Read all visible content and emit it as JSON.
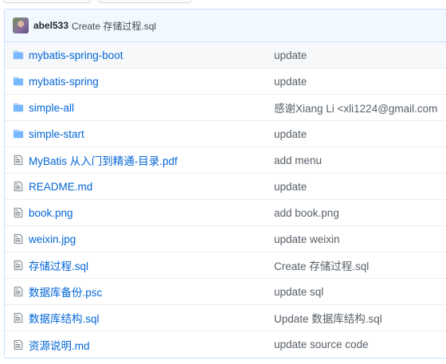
{
  "commit": {
    "author": "abel533",
    "message": "Create 存储过程.sql"
  },
  "colors": {
    "link": "#0366d6",
    "folder_icon": "#79b8ff",
    "file_icon": "#6a737d",
    "header_bg": "#f1f8ff"
  },
  "files": [
    {
      "type": "folder",
      "icon": "folder-icon",
      "name": "mybatis-spring-boot",
      "message": "update"
    },
    {
      "type": "folder",
      "icon": "folder-icon",
      "name": "mybatis-spring",
      "message": "update"
    },
    {
      "type": "folder",
      "icon": "folder-icon",
      "name": "simple-all",
      "message": "感谢Xiang Li <xli1224@gmail.com"
    },
    {
      "type": "folder",
      "icon": "folder-icon",
      "name": "simple-start",
      "message": "update"
    },
    {
      "type": "file",
      "icon": "file-icon",
      "name": "MyBatis 从入门到精通-目录.pdf",
      "message": "add menu"
    },
    {
      "type": "file",
      "icon": "file-icon",
      "name": "README.md",
      "message": "update"
    },
    {
      "type": "file",
      "icon": "file-icon",
      "name": "book.png",
      "message": "add book.png"
    },
    {
      "type": "file",
      "icon": "file-icon",
      "name": "weixin.jpg",
      "message": "update weixin"
    },
    {
      "type": "file",
      "icon": "file-icon",
      "name": "存储过程.sql",
      "message": "Create 存储过程.sql"
    },
    {
      "type": "file",
      "icon": "file-icon",
      "name": "数据库备份.psc",
      "message": "update sql"
    },
    {
      "type": "file",
      "icon": "file-icon",
      "name": "数据库结构.sql",
      "message": "Update 数据库结构.sql"
    },
    {
      "type": "file",
      "icon": "file-icon",
      "name": "资源说明.md",
      "message": "update source code"
    }
  ]
}
